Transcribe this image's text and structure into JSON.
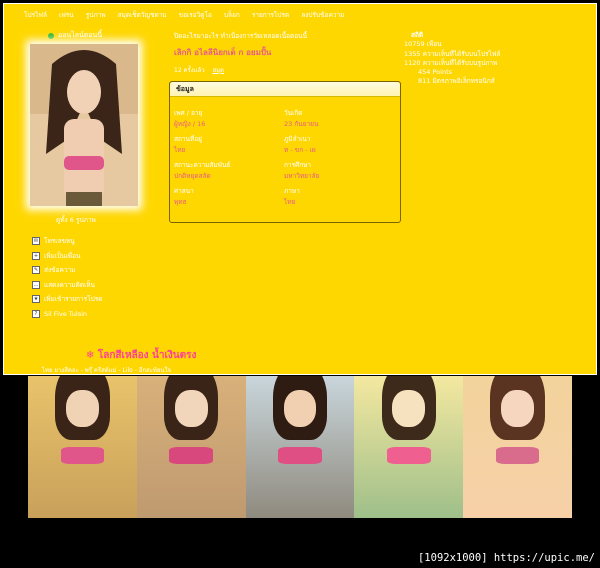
{
  "nav": [
    "โปรไฟล์",
    "เฟรน",
    "รูปภาพ",
    "สมุดเช็ตวัญชดาม",
    "ขอเรอวิดูโอ",
    "บล็อก",
    "รายการโปรด",
    "ลงปรับข้อความ"
  ],
  "online_text": "ออนไลน์ตอนนี้",
  "photo_count": "ดูทั้ง 6 รูปภาพ",
  "actions": [
    {
      "icon": "mail-icon",
      "label": "โทรเลขหนู"
    },
    {
      "icon": "add-friend-icon",
      "label": "เพิ่มเป็นเพื่อน"
    },
    {
      "icon": "message-icon",
      "label": "ส่งข้อความ"
    },
    {
      "icon": "comment-icon",
      "label": "แสดงความคิดเห็น"
    },
    {
      "icon": "favorite-icon",
      "label": "เพิ่มเข้ารายการโปรด"
    },
    {
      "icon": "help-icon",
      "label": "Sil Five Tulsin"
    }
  ],
  "status_line": "ปิดอะไรมาอะไร ทำเนื่องการวัยเหลอดเนื้อตอนนี้",
  "display_name": "เลิกกิ อไลลีนิยกเด็ ก อยมปั้น",
  "meta": {
    "text": "12 ครั้งแล้ว",
    "link": "สมุด"
  },
  "info": {
    "header": "ข้อมูล",
    "fields": [
      {
        "label": "เพศ / อายุ",
        "value": "ผู้หญิง / 16"
      },
      {
        "label": "วันเกิด",
        "value": "23 กันยายน"
      },
      {
        "label": "สถานที่อยู่",
        "value": "ไทย"
      },
      {
        "label": "ภูมิลำเนา",
        "value": "ท - ขก - เผ"
      },
      {
        "label": "สถานะความสัมพันธ์",
        "value": "ปกติหยุดสลัด"
      },
      {
        "label": "การศึกษา",
        "value": "มหาวิทยาลัย"
      },
      {
        "label": "ศาสนา",
        "value": "พุทธ"
      },
      {
        "label": "ภาษา",
        "value": "ไทย"
      }
    ]
  },
  "stats": {
    "title": "สถิติ",
    "lines": [
      "10759 เพื่อน",
      "1355 ความเห็นที่ได้รับบนโปรไฟล์",
      "1120 ความเห็นที่ได้รับบนรูปภาพ"
    ],
    "sub": [
      "454 Points",
      "811 มิตรภาพอิเล็กทรอนิกส์"
    ]
  },
  "footer": {
    "title": "โลกสีเหลือง น้ำเงินตรง",
    "sub": "ไทย ยางสีคละ - พรุ๊ ครีสต์แม่ - Lilo - อีกสะท้อนใจ"
  },
  "credit": "[1092x1000] https://upic.me/",
  "colors": {
    "page_bg": "#FFD700",
    "name_pink": "#e85b8a",
    "footer_pink": "#ff3f9a"
  }
}
